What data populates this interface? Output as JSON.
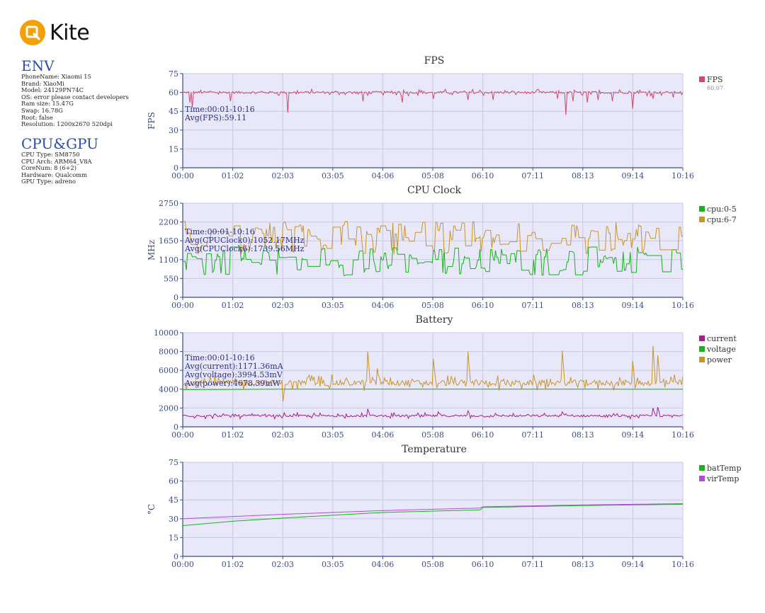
{
  "app": {
    "logo_text": "Kite"
  },
  "env": {
    "title": "ENV",
    "lines": [
      "PhoneName: Xiaomi 15",
      "Brand: XiaoMi",
      "Model: 24129PN74C",
      "OS: error please contact developers",
      "Ram size: 15.47G",
      "Swap: 16.78G",
      "Root: false",
      "Resolution: 1200x2670 520dpi"
    ]
  },
  "cpugpu": {
    "title": "CPU&GPU",
    "lines": [
      "CPU Type: SM8750",
      "CPU Arch: ARM64_V8A",
      "CoreNum: 8 (6+2)",
      "Hardware: Qualcomm",
      "GPU Type: adreno"
    ]
  },
  "colors": {
    "plot_bg": "#e8e8fa",
    "grid": "#c9c9e0",
    "axis": "#3a4c8c",
    "fps": "#d2476a",
    "cpu0": "#19b219",
    "cpu6": "#c89628",
    "current": "#aa1e8c",
    "voltage": "#19b219",
    "power": "#c89628",
    "batTemp": "#19b219",
    "virTemp": "#b44bd2"
  },
  "chart_data": [
    {
      "type": "line",
      "title": "FPS",
      "ylabel": "FPS",
      "xlabel": "",
      "x_ticks": [
        "00:00",
        "01:02",
        "02:03",
        "03:05",
        "04:06",
        "05:08",
        "06:10",
        "07:11",
        "08:13",
        "09:14",
        "10:16"
      ],
      "ylim": [
        0,
        75
      ],
      "y_ticks": [
        0,
        15,
        30,
        45,
        60,
        75
      ],
      "grid": true,
      "legend_position": "right",
      "legend": [
        {
          "name": "FPS",
          "sub": "60.07"
        }
      ],
      "annotations": [
        "Time:00:01-10:16",
        "Avg(FPS):59.11"
      ],
      "series": [
        {
          "name": "FPS",
          "color_key": "fps",
          "profile": {
            "base": 60,
            "noise": 1.5,
            "dips": [
              [
                0.015,
                52
              ],
              [
                0.02,
                48
              ],
              [
                0.095,
                53
              ],
              [
                0.21,
                44
              ],
              [
                0.36,
                53
              ],
              [
                0.44,
                52
              ],
              [
                0.5,
                55
              ],
              [
                0.57,
                54
              ],
              [
                0.62,
                54
              ],
              [
                0.75,
                55
              ],
              [
                0.765,
                47
              ],
              [
                0.765,
                42
              ],
              [
                0.78,
                53
              ],
              [
                0.81,
                52
              ],
              [
                0.83,
                54
              ],
              [
                0.86,
                53
              ],
              [
                0.9,
                47
              ],
              [
                0.94,
                55
              ],
              [
                0.98,
                56
              ]
            ]
          }
        }
      ]
    },
    {
      "type": "line",
      "title": "CPU Clock",
      "ylabel": "MHz",
      "xlabel": "",
      "x_ticks": [
        "00:00",
        "01:02",
        "02:03",
        "03:05",
        "04:06",
        "05:08",
        "06:10",
        "07:11",
        "08:13",
        "09:14",
        "10:16"
      ],
      "ylim": [
        0,
        2750
      ],
      "y_ticks": [
        0,
        550,
        1100,
        1650,
        2200,
        2750
      ],
      "grid": true,
      "legend_position": "right",
      "legend": [
        {
          "name": "cpu:0-5"
        },
        {
          "name": "cpu:6-7"
        }
      ],
      "annotations": [
        "Time:00:01-10:16",
        "Avg(CPUClock0):1052.17MHz",
        "Avg(CPUClock6):1739.56MHz"
      ],
      "series": [
        {
          "name": "cpu:0-5",
          "color_key": "cpu0",
          "profile": {
            "base": 1052,
            "noise": 420,
            "min": 550,
            "max": 2000,
            "step": true
          }
        },
        {
          "name": "cpu:6-7",
          "color_key": "cpu6",
          "profile": {
            "base": 1740,
            "noise": 480,
            "min": 1050,
            "max": 2300,
            "step": true
          }
        }
      ]
    },
    {
      "type": "line",
      "title": "Battery",
      "ylabel": "",
      "xlabel": "",
      "x_ticks": [
        "00:00",
        "01:02",
        "02:03",
        "03:05",
        "04:06",
        "05:08",
        "06:10",
        "07:11",
        "08:13",
        "09:14",
        "10:16"
      ],
      "ylim": [
        0,
        10000
      ],
      "y_ticks": [
        0,
        2000,
        4000,
        6000,
        8000,
        10000
      ],
      "grid": true,
      "legend_position": "right",
      "legend": [
        {
          "name": "current"
        },
        {
          "name": "voltage"
        },
        {
          "name": "power"
        }
      ],
      "annotations": [
        "Time:00:01-10:16",
        "Avg(current):1171.36mA",
        "Avg(voltage):3994.53mV",
        "Avg(power):4678.39mW"
      ],
      "series": [
        {
          "name": "current",
          "color_key": "current",
          "profile": {
            "base": 1171,
            "noise": 180,
            "min": 700,
            "max": 2100,
            "spikes": [
              [
                0.37,
                1900
              ],
              [
                0.51,
                1600
              ],
              [
                0.57,
                1700
              ],
              [
                0.76,
                1600
              ],
              [
                0.94,
                2000
              ],
              [
                0.95,
                2100
              ]
            ]
          }
        },
        {
          "name": "voltage",
          "color_key": "voltage",
          "profile": {
            "points": [
              [
                0,
                3950
              ],
              [
                0.2,
                4000
              ],
              [
                0.35,
                4000
              ],
              [
                0.6,
                4010
              ],
              [
                1,
                3990
              ]
            ]
          }
        },
        {
          "name": "power",
          "color_key": "power",
          "profile": {
            "base": 4678,
            "noise": 500,
            "min": 2700,
            "max": 8600,
            "spikes": [
              [
                0.2,
                2700
              ],
              [
                0.37,
                8000
              ],
              [
                0.39,
                6200
              ],
              [
                0.5,
                7200
              ],
              [
                0.57,
                8000
              ],
              [
                0.76,
                8100
              ],
              [
                0.9,
                7000
              ],
              [
                0.94,
                8600
              ],
              [
                0.95,
                7600
              ]
            ]
          }
        }
      ]
    },
    {
      "type": "line",
      "title": "Temperature",
      "ylabel": "°C",
      "xlabel": "",
      "x_ticks": [
        "00:00",
        "01:02",
        "02:03",
        "03:05",
        "04:06",
        "05:08",
        "06:10",
        "07:11",
        "08:13",
        "09:14",
        "10:16"
      ],
      "ylim": [
        0,
        75
      ],
      "y_ticks": [
        0,
        15,
        30,
        45,
        60,
        75
      ],
      "grid": true,
      "legend_position": "right",
      "legend": [
        {
          "name": "batTemp"
        },
        {
          "name": "virTemp"
        }
      ],
      "annotations": [],
      "series": [
        {
          "name": "batTemp",
          "color_key": "batTemp",
          "profile": {
            "points": [
              [
                0,
                24.5
              ],
              [
                0.1,
                28
              ],
              [
                0.22,
                31
              ],
              [
                0.4,
                35
              ],
              [
                0.59,
                37
              ],
              [
                0.595,
                37
              ],
              [
                0.6,
                39
              ],
              [
                0.8,
                40.5
              ],
              [
                1,
                41.5
              ]
            ]
          }
        },
        {
          "name": "virTemp",
          "color_key": "virTemp",
          "profile": {
            "points": [
              [
                0,
                30
              ],
              [
                0.2,
                33.5
              ],
              [
                0.4,
                36.5
              ],
              [
                0.595,
                38.5
              ],
              [
                0.6,
                39.5
              ],
              [
                0.8,
                41
              ],
              [
                1,
                42
              ]
            ]
          }
        }
      ]
    }
  ]
}
